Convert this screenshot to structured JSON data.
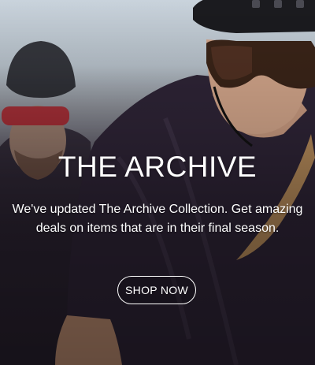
{
  "hero": {
    "title": "THE ARCHIVE",
    "description": "We've updated The Archive Collection. Get amazing deals on items that are in their final season.",
    "cta_label": "SHOP NOW"
  },
  "colors": {
    "text": "#ffffff",
    "jersey": "#2e2436",
    "helmet": "#1b1b1f",
    "sky": "#c9d3dc",
    "lens_red": "#b2262b"
  }
}
